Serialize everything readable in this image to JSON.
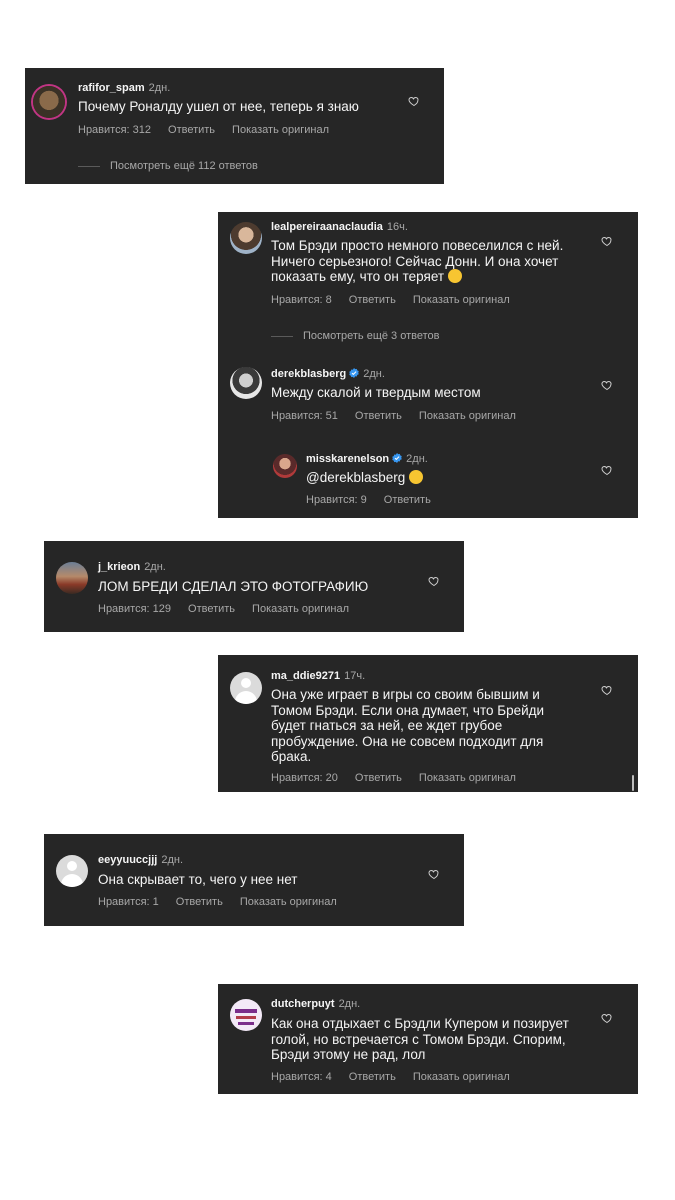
{
  "verified_color": "#3897f0",
  "comments": [
    {
      "username": "rafifor_spam",
      "time": "2дн.",
      "text": "Почему Роналду ушел от нее, теперь я знаю",
      "likes": "Нравится: 312",
      "reply": "Ответить",
      "original": "Показать оригинал",
      "more": "Посмотреть ещё 112 ответов"
    },
    {
      "username": "lealpereiraanaclaudia",
      "time": "16ч.",
      "text_lines": [
        "Том Брэди просто немного повеселился с ней.",
        "Ничего серьезного! Сейчас Донн. И она хочет",
        "показать ему, что он теряет"
      ],
      "likes": "Нравится: 8",
      "reply": "Ответить",
      "original": "Показать оригинал",
      "more": "Посмотреть ещё 3 ответов",
      "replies": [
        {
          "username": "derekblasberg",
          "time": "2дн.",
          "text": "Между скалой и твердым местом",
          "likes": "Нравится: 51",
          "reply": "Ответить",
          "original": "Показать оригинал"
        },
        {
          "username": "misskarenelson",
          "time": "2дн.",
          "text": "@derekblasberg",
          "likes": "Нравится: 9",
          "reply": "Ответить"
        }
      ]
    },
    {
      "username": "j_krieon",
      "time": "2дн.",
      "text": "ЛОМ БРЕДИ СДЕЛАЛ ЭТО ФОТОГРАФИЮ",
      "likes": "Нравится: 129",
      "reply": "Ответить",
      "original": "Показать оригинал"
    },
    {
      "username": "ma_ddie9271",
      "time": "17ч.",
      "text_lines": [
        "Она уже играет в игры со своим бывшим и",
        "Томом Брэди. Если она думает, что Брейди",
        "будет гнаться за ней, ее ждет грубое",
        "пробуждение. Она не совсем подходит для",
        "брака."
      ],
      "likes": "Нравится: 20",
      "reply": "Ответить",
      "original": "Показать оригинал"
    },
    {
      "username": "eeyyuuccjjj",
      "time": "2дн.",
      "text": "Она скрывает то, чего у нее нет",
      "likes": "Нравится: 1",
      "reply": "Ответить",
      "original": "Показать оригинал"
    },
    {
      "username": "dutcherpuyt",
      "time": "2дн.",
      "text_lines": [
        "Как она отдыхает с Брэдли Купером и позирует",
        "голой, но встречается с Томом Брэди. Спорим,",
        "Брэди этому не рад, лол"
      ],
      "likes": "Нравится: 4",
      "reply": "Ответить",
      "original": "Показать оригинал"
    }
  ]
}
